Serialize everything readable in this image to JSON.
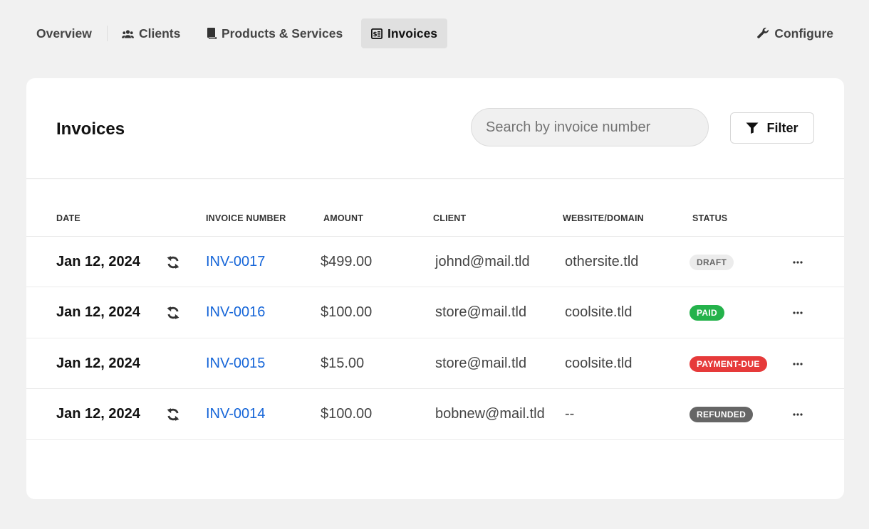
{
  "nav": {
    "overview": "Overview",
    "clients": "Clients",
    "products": "Products & Services",
    "invoices": "Invoices",
    "configure": "Configure"
  },
  "card": {
    "title": "Invoices",
    "search_placeholder": "Search by invoice number",
    "filter_label": "Filter"
  },
  "table": {
    "headers": {
      "date": "DATE",
      "invoice_number": "INVOICE NUMBER",
      "amount": "AMOUNT",
      "client": "CLIENT",
      "website": "WEBSITE/DOMAIN",
      "status": "STATUS"
    },
    "rows": [
      {
        "date": "Jan 12, 2024",
        "recurring": true,
        "invoice": "INV-0017",
        "amount": "$499.00",
        "client": "johnd@mail.tld",
        "website": "othersite.tld",
        "status": "DRAFT"
      },
      {
        "date": "Jan 12, 2024",
        "recurring": true,
        "invoice": "INV-0016",
        "amount": "$100.00",
        "client": "store@mail.tld",
        "website": "coolsite.tld",
        "status": "PAID"
      },
      {
        "date": "Jan 12, 2024",
        "recurring": false,
        "invoice": "INV-0015",
        "amount": "$15.00",
        "client": "store@mail.tld",
        "website": "coolsite.tld",
        "status": "PAYMENT-DUE"
      },
      {
        "date": "Jan 12, 2024",
        "recurring": true,
        "invoice": "INV-0014",
        "amount": "$100.00",
        "client": "bobnew@mail.tld",
        "website": "--",
        "status": "REFUNDED"
      }
    ]
  },
  "colors": {
    "link": "#1565d8",
    "paid": "#24b24b",
    "payment_due": "#e63a3a",
    "refunded": "#666666",
    "draft": "#ececec"
  },
  "icons": {
    "clients": "users-icon",
    "products": "book-icon",
    "invoices": "invoice-icon",
    "configure": "wrench-icon",
    "filter": "filter-icon",
    "recurring": "refresh-icon",
    "row_actions": "more-horizontal-icon"
  }
}
